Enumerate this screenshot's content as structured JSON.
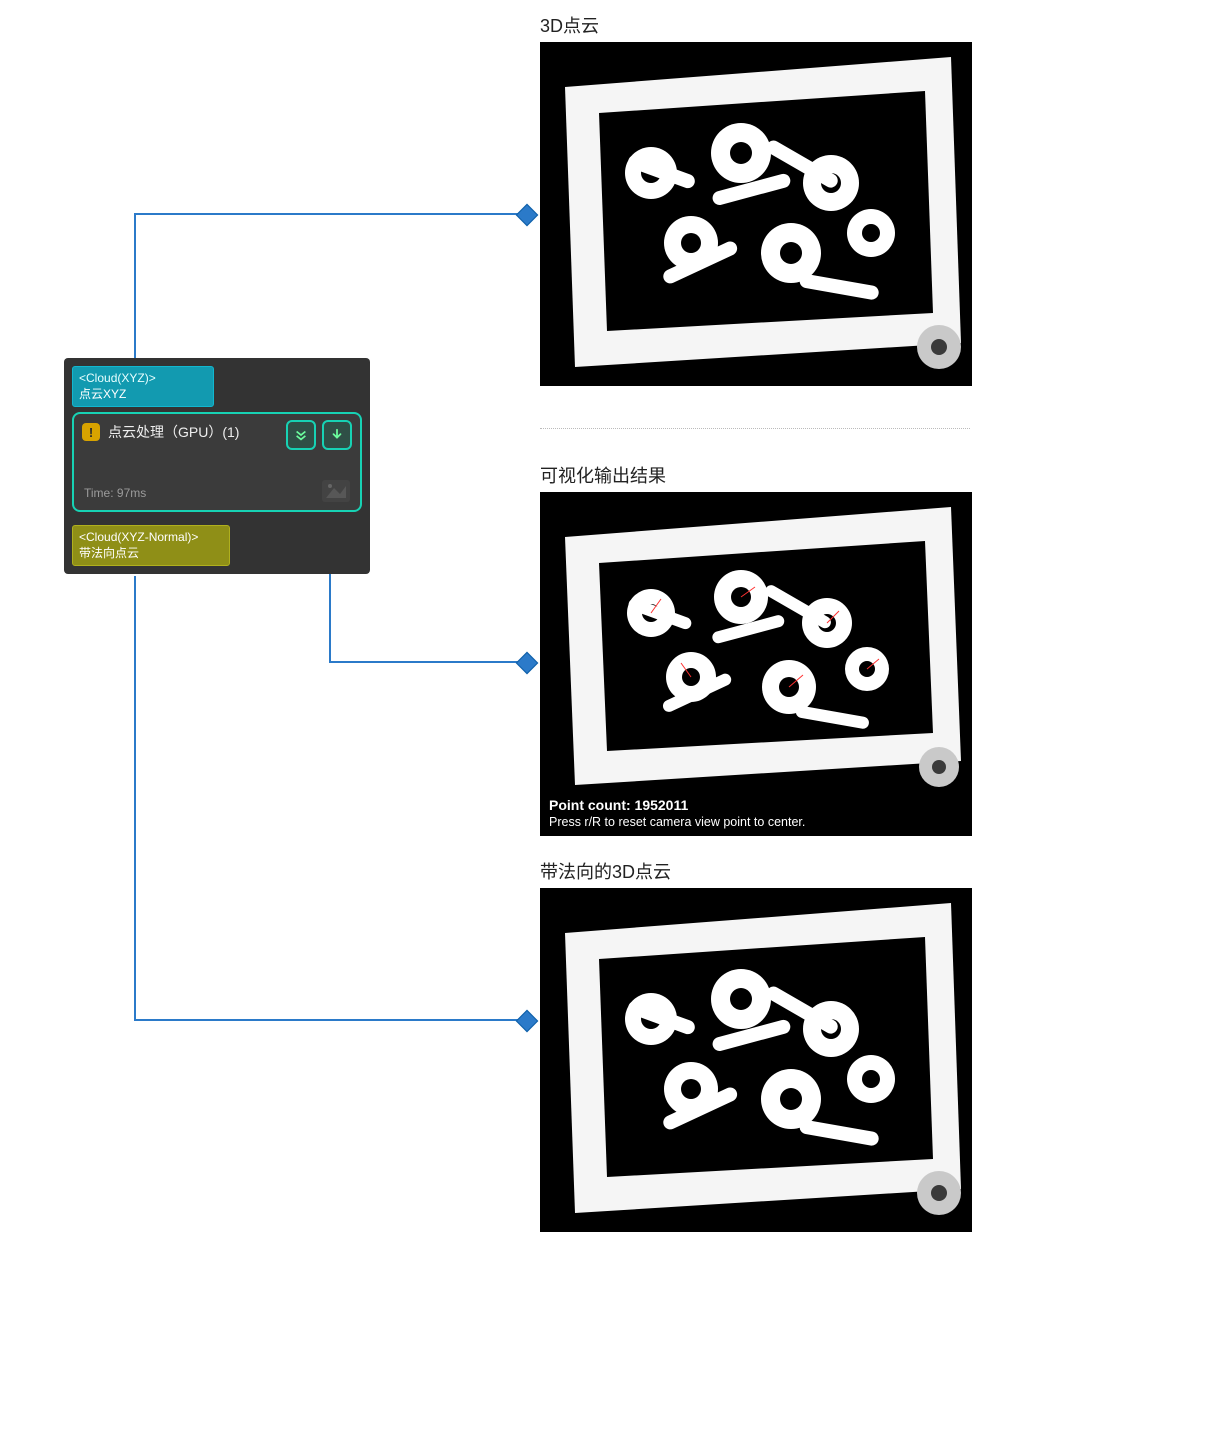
{
  "connectors": {
    "color": "#2b7ac9"
  },
  "node": {
    "port_in": {
      "type": "<Cloud(XYZ)>",
      "label": "点云XYZ"
    },
    "port_out": {
      "type": "<Cloud(XYZ-Normal)>",
      "label": "带法向点云"
    },
    "op": {
      "warning_glyph": "!",
      "title": "点云处理（GPU）(1)",
      "time_label": "Time: 97ms"
    }
  },
  "panels": {
    "pc_top": {
      "title": "3D点云"
    },
    "pc_mid": {
      "title": "可视化输出结果",
      "point_count_line": "Point count: 1952011",
      "hint_line": "Press r/R to reset camera view point to center."
    },
    "pc_bottom": {
      "title": "带法向的3D点云"
    }
  }
}
